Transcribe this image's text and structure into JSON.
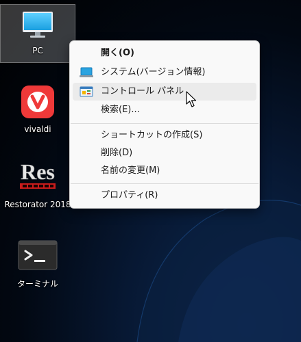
{
  "desktop": {
    "icons": [
      {
        "label": "PC",
        "icon": "monitor-icon",
        "selected": true
      },
      {
        "label": "vivaldi",
        "icon": "vivaldi-icon"
      },
      {
        "label": "Restorator 2018",
        "icon": "restorator-icon",
        "logo_text": "Res"
      },
      {
        "label": "ターミナル",
        "icon": "terminal-icon"
      }
    ]
  },
  "context_menu": {
    "items": [
      {
        "label": "開く(O)",
        "bold": true
      },
      {
        "label": "システム(バージョン情報)",
        "icon": "laptop-icon"
      },
      {
        "label": "コントロール パネル",
        "icon": "control-panel-icon",
        "hovered": true
      },
      {
        "label": "検索(E)..."
      },
      {
        "label": "ショートカットの作成(S)"
      },
      {
        "label": "削除(D)"
      },
      {
        "label": "名前の変更(M)"
      },
      {
        "label": "プロパティ(R)"
      }
    ]
  },
  "colors": {
    "menu_bg": "#f9f9f9",
    "hover_bg": "#ebebeb",
    "vivaldi_red": "#ef3939",
    "monitor_blue": "#29b6f6"
  }
}
